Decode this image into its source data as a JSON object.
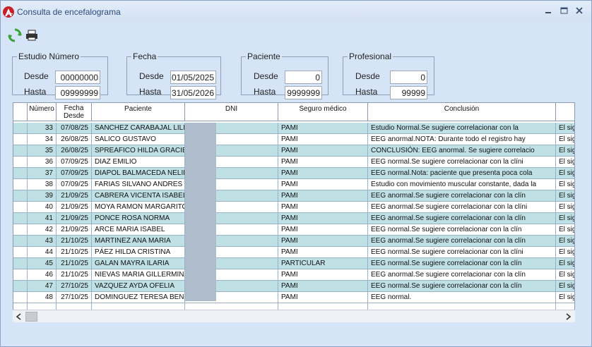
{
  "window": {
    "title": "Consulta de encefalograma"
  },
  "filters": {
    "estudio": {
      "legend": "Estudio Número",
      "desde_label": "Desde",
      "desde": "00000000",
      "hasta_label": "Hasta",
      "hasta": "09999999"
    },
    "fecha": {
      "legend": "Fecha",
      "desde_label": "Desde",
      "desde": "01/05/2025",
      "hasta_label": "Hasta",
      "hasta": "31/05/2026"
    },
    "paciente": {
      "legend": "Paciente",
      "desde_label": "Desde",
      "desde": "0",
      "hasta_label": "Hasta",
      "hasta": "9999999"
    },
    "profesional": {
      "legend": "Profesional",
      "desde_label": "Desde",
      "desde": "0",
      "hasta_label": "Hasta",
      "hasta": "99999"
    }
  },
  "table": {
    "headers": {
      "numero": "Número",
      "fecha": "Fecha\nDesde",
      "paciente": "Paciente",
      "dni": "DNI",
      "seguro": "Seguro médico",
      "conclusion": "Conclusión"
    },
    "rows": [
      {
        "numero": "33",
        "fecha": "07/08/25",
        "paciente": "SANCHEZ CARABAJAL LILIA",
        "seguro": "PAMI",
        "conclusion": " Estudio Normal.Se sugiere correlacionar con la",
        "extra": "El sig"
      },
      {
        "numero": "34",
        "fecha": "26/08/25",
        "paciente": "SALICO GUSTAVO",
        "seguro": "PAMI",
        "conclusion": "EEG anormal.NOTA: Durante todo el registro hay",
        "extra": "El sig"
      },
      {
        "numero": "35",
        "fecha": "26/08/25",
        "paciente": "SPREAFICO HILDA GRACIEL",
        "seguro": "PAMI",
        "conclusion": "CONCLUSIÓN: EEG anormal. Se sugiere correlacio",
        "extra": "El sig"
      },
      {
        "numero": "36",
        "fecha": "07/09/25",
        "paciente": "DIAZ EMILIO",
        "seguro": "PAMI",
        "conclusion": "EEG normal.Se sugiere correlacionar con la clíni",
        "extra": "El sig"
      },
      {
        "numero": "37",
        "fecha": "07/09/25",
        "paciente": "DIAPOL BALMACEDA NELID",
        "seguro": "PAMI",
        "conclusion": "EEG normal.Nota: paciente que presenta poca cola",
        "extra": "El sig"
      },
      {
        "numero": "38",
        "fecha": "07/09/25",
        "paciente": "FARIAS SILVANO ANDRES",
        "seguro": "PAMI",
        "conclusion": "Estudio con movimiento muscular constante, dada la",
        "extra": "El sig"
      },
      {
        "numero": "39",
        "fecha": "21/09/25",
        "paciente": "CABRERA VICENTA ISABEL",
        "seguro": "PAMI",
        "conclusion": "EEG anormal.Se sugiere correlacionar con la clín",
        "extra": "El sig"
      },
      {
        "numero": "40",
        "fecha": "21/09/25",
        "paciente": "MOYA RAMON MARGARITO",
        "seguro": "PAMI",
        "conclusion": "EEG anormal.Se sugiere correlacionar con la clíni",
        "extra": "El sig"
      },
      {
        "numero": "41",
        "fecha": "21/09/25",
        "paciente": "PONCE ROSA NORMA",
        "seguro": "PAMI",
        "conclusion": "EEG anormal.Se sugiere correlacionar con la clín",
        "extra": "El sig"
      },
      {
        "numero": "42",
        "fecha": "21/09/25",
        "paciente": "ARCE MARIA ISABEL",
        "seguro": "PAMI",
        "conclusion": "EEG normal.Se sugiere correlacionar con la clín",
        "extra": "El sig"
      },
      {
        "numero": "43",
        "fecha": "21/10/25",
        "paciente": "MARTINEZ ANA MARIA",
        "seguro": "PAMI",
        "conclusion": "EEG anormal.Se sugiere correlacionar con la clín",
        "extra": "El sig"
      },
      {
        "numero": "44",
        "fecha": "21/10/25",
        "paciente": "PÁEZ HILDA CRISTINA",
        "seguro": "PAMI",
        "conclusion": "EEG normal.Se sugiere correlacionar con la clíni",
        "extra": "El sig"
      },
      {
        "numero": "45",
        "fecha": "21/10/25",
        "paciente": "GALAN MAYRA ILARIA",
        "seguro": "PARTICULAR",
        "conclusion": "EEG normal.Se sugiere correlacionar con la clín",
        "extra": "El sig"
      },
      {
        "numero": "46",
        "fecha": "21/10/25",
        "paciente": "NIEVAS MARIA GILLERMINA",
        "seguro": "PAMI",
        "conclusion": "EEG anormal.Se sugiere correlacionar con la clín",
        "extra": "El sig"
      },
      {
        "numero": "47",
        "fecha": "27/10/25",
        "paciente": "VAZQUEZ AYDA OFELIA",
        "seguro": "PAMI",
        "conclusion": "EEG normal.Se sugiere correlacionar con la clín",
        "extra": "El sig"
      },
      {
        "numero": "48",
        "fecha": "27/10/25",
        "paciente": "DOMINGUEZ TERESA BENIT",
        "seguro": "PAMI",
        "conclusion": "EEG normal.",
        "extra": "El sig"
      }
    ]
  },
  "icons": {
    "app": "app-logo-icon",
    "refresh": "refresh-icon",
    "print": "printer-icon"
  },
  "colors": {
    "row_alt": "#bfe1e6",
    "window_bg": "#d6e4f7"
  }
}
